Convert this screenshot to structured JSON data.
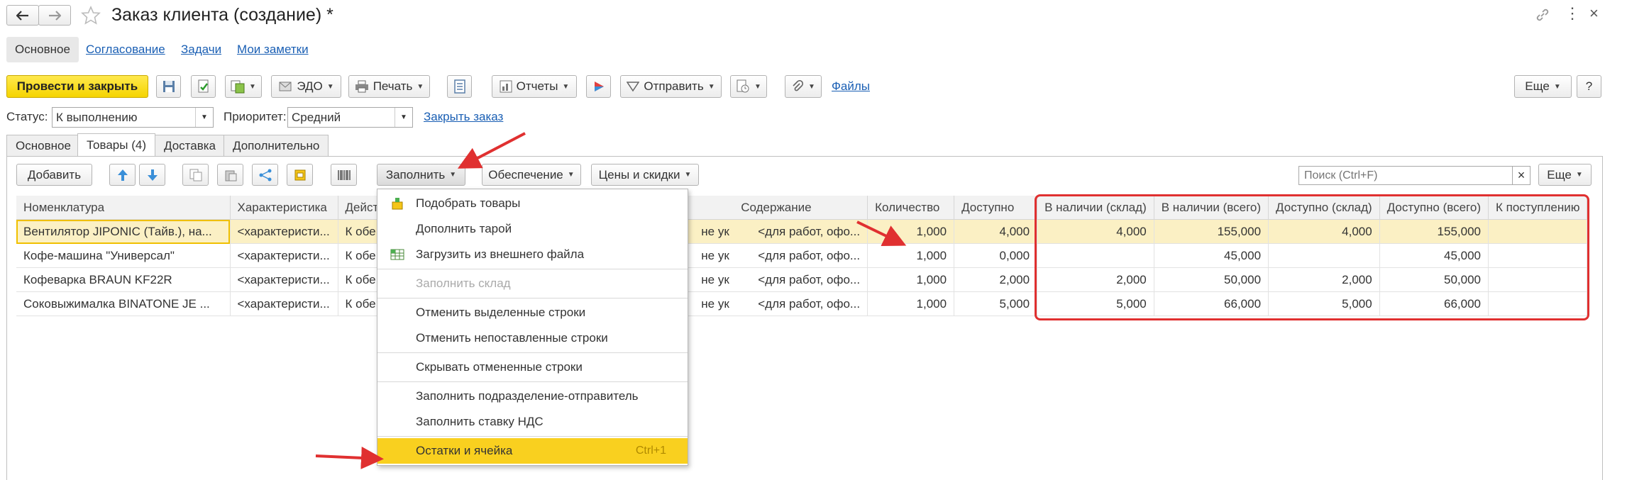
{
  "window": {
    "title": "Заказ клиента (создание) *"
  },
  "section_tabs": [
    {
      "label": "Основное"
    },
    {
      "label": "Согласование"
    },
    {
      "label": "Задачи"
    },
    {
      "label": "Мои заметки"
    }
  ],
  "toolbar": {
    "post_close_label": "Провести и закрыть",
    "edo_label": "ЭДО",
    "print_label": "Печать",
    "reports_label": "Отчеты",
    "send_label": "Отправить",
    "files_label": "Файлы",
    "more_label": "Еще",
    "help_label": "?"
  },
  "status_row": {
    "status_label": "Статус:",
    "status_value": "К выполнению",
    "priority_label": "Приоритет:",
    "priority_value": "Средний",
    "close_order_label": "Закрыть заказ"
  },
  "form_tabs": [
    {
      "label": "Основное"
    },
    {
      "label": "Товары (4)"
    },
    {
      "label": "Доставка"
    },
    {
      "label": "Дополнительно"
    }
  ],
  "goods_toolbar": {
    "add_label": "Добавить",
    "fill_label": "Заполнить",
    "supply_label": "Обеспечение",
    "prices_label": "Цены и скидки",
    "search_placeholder": "Поиск (Ctrl+F)",
    "more_label": "Еще"
  },
  "table": {
    "headers": [
      "Номенклатура",
      "Характеристика",
      "Дейст",
      "Содержание",
      "Количество",
      "Доступно",
      "В наличии (склад)",
      "В наличии (всего)",
      "Доступно (склад)",
      "Доступно (всего)",
      "К поступлению"
    ],
    "rows": [
      {
        "item": "Вентилятор JIPONIC (Тайв.), на...",
        "char": "<характеристи...",
        "action": "К обе",
        "hidden": "не ук",
        "content": "<для работ, офо...",
        "qty": "1,000",
        "avail": "4,000",
        "stock_wh": "4,000",
        "stock_all": "155,000",
        "avail_wh": "4,000",
        "avail_all": "155,000",
        "incoming": ""
      },
      {
        "item": "Кофе-машина \"Универсал\"",
        "char": "<характеристи...",
        "action": "К обе",
        "hidden": "не ук",
        "content": "<для работ, офо...",
        "qty": "1,000",
        "avail": "0,000",
        "stock_wh": "",
        "stock_all": "45,000",
        "avail_wh": "",
        "avail_all": "45,000",
        "incoming": ""
      },
      {
        "item": "Кофеварка BRAUN KF22R",
        "char": "<характеристи...",
        "action": "К обе",
        "hidden": "не ук",
        "content": "<для работ, офо...",
        "qty": "1,000",
        "avail": "2,000",
        "stock_wh": "2,000",
        "stock_all": "50,000",
        "avail_wh": "2,000",
        "avail_all": "50,000",
        "incoming": ""
      },
      {
        "item": "Соковыжималка  BINATONE JE ...",
        "char": "<характеристи...",
        "action": "К обе",
        "hidden": "не ук",
        "content": "<для работ, офо...",
        "qty": "1,000",
        "avail": "5,000",
        "stock_wh": "5,000",
        "stock_all": "66,000",
        "avail_wh": "5,000",
        "avail_all": "66,000",
        "incoming": ""
      }
    ]
  },
  "fill_menu": {
    "items": [
      {
        "label": "Подобрать товары"
      },
      {
        "label": "Дополнить тарой"
      },
      {
        "label": "Загрузить из внешнего файла"
      },
      {
        "label": "Заполнить склад"
      },
      {
        "label": "Отменить выделенные строки"
      },
      {
        "label": "Отменить непоставленные строки"
      },
      {
        "label": "Скрывать отмененные строки"
      },
      {
        "label": "Заполнить подразделение-отправитель"
      },
      {
        "label": "Заполнить ставку НДС"
      },
      {
        "label": "Остатки и ячейка",
        "shortcut": "Ctrl+1"
      }
    ]
  },
  "colors": {
    "accent_yellow": "#f5d400",
    "menu_highlight": "#f9d01f",
    "annotation_red": "#e03030",
    "link_blue": "#1a5fb4",
    "value_blue": "#1a73c8",
    "value_red": "#e02020"
  }
}
